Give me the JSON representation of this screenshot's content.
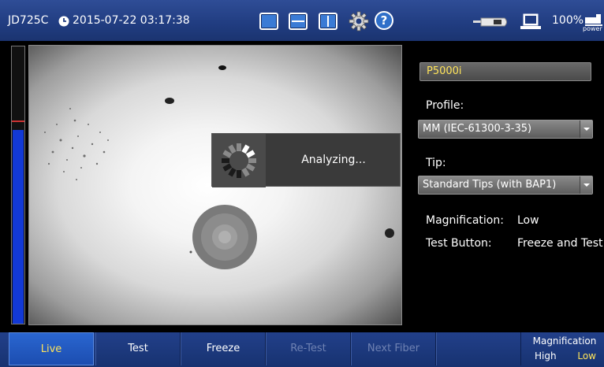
{
  "status_bar": {
    "device": "JD725C",
    "datetime": "2015-07-22 03:17:38",
    "battery": "100%",
    "power_label": "power"
  },
  "level_meter": {
    "level_fraction": 0.7
  },
  "overlay": {
    "message": "Analyzing..."
  },
  "settings": {
    "probe_id": "P5000i",
    "profile_label": "Profile:",
    "profile_value": "MM (IEC-61300-3-35)",
    "tip_label": "Tip:",
    "tip_value": "Standard Tips (with BAP1)",
    "magnification_label": "Magnification:",
    "magnification_value": "Low",
    "test_button_label": "Test Button:",
    "test_button_value": "Freeze and Test"
  },
  "softkeys": [
    {
      "label": "Live",
      "state": "active"
    },
    {
      "label": "Test",
      "state": "enabled"
    },
    {
      "label": "Freeze",
      "state": "enabled"
    },
    {
      "label": "Re-Test",
      "state": "disabled"
    },
    {
      "label": "Next Fiber",
      "state": "disabled"
    },
    {
      "label": "",
      "state": "empty"
    }
  ],
  "magnification_key": {
    "title": "Magnification",
    "high": "High",
    "low": "Low"
  },
  "colors": {
    "accent_yellow": "#ffe45a",
    "bar_blue": "#203c80",
    "level_blue": "#1239d6"
  }
}
